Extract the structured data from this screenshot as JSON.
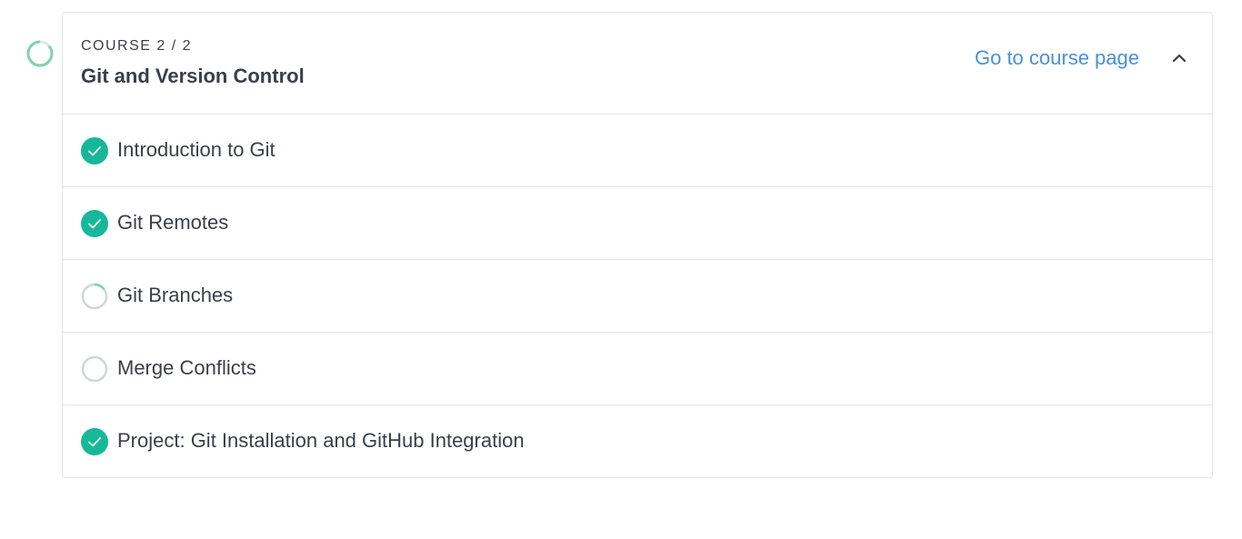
{
  "course": {
    "number_label": "COURSE 2 / 2",
    "title": "Git and Version Control",
    "link_label": "Go to course page",
    "collapse_icon": "chevron-up-icon"
  },
  "lessons": [
    {
      "label": "Introduction to Git",
      "status": "complete",
      "icon": "check-circle-icon"
    },
    {
      "label": "Git Remotes",
      "status": "complete",
      "icon": "check-circle-icon"
    },
    {
      "label": "Git Branches",
      "status": "in-progress",
      "icon": "progress-ring-icon"
    },
    {
      "label": "Merge Conflicts",
      "status": "not-started",
      "icon": "empty-circle-icon"
    },
    {
      "label": "Project: Git Installation and GitHub Integration",
      "status": "complete",
      "icon": "check-circle-icon"
    }
  ],
  "colors": {
    "complete": "#17b897",
    "progress": "#7ed4a9",
    "empty": "#d1d6dc",
    "link": "#4a90d9",
    "text": "#3a3f4a",
    "border": "#e2e4e8"
  }
}
